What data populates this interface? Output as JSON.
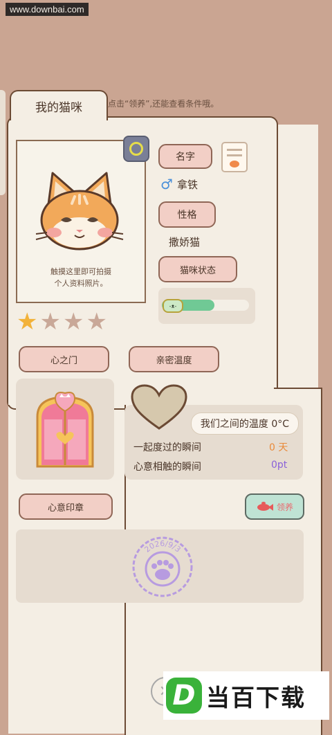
{
  "watermark": "www.downbai.com",
  "tab": {
    "title": "我的猫咪"
  },
  "hint": "点击“领养”,还能查看条件哦。",
  "profile": {
    "photo_caption_line1": "触摸这里即可拍摄",
    "photo_caption_line2": "个人资料照片。",
    "name_label": "名字",
    "gender_symbol": "♂",
    "name_value": "拿铁",
    "personality_label": "性格",
    "personality_value": "撒娇猫",
    "status_label": "猫咪状态",
    "status_face": "-ᴥ-",
    "status_level": 0.6,
    "stars_filled": 1,
    "stars_total": 5
  },
  "heart_gate": {
    "label": "心之门"
  },
  "intimacy": {
    "label": "亲密温度",
    "temperature_text": "我们之间的温度 0°C",
    "moments_label": "一起度过的瞬间",
    "moments_value": "0 天",
    "touch_label": "心意相触的瞬间",
    "touch_value": "0pt"
  },
  "seal": {
    "label": "心意印章",
    "adopt_label": "领养",
    "stamp_date": "2026/9/3"
  },
  "brand_logo": {
    "letter": "D",
    "text": "当百下载"
  },
  "colors": {
    "background": "#caa592",
    "panel": "#f4eee4",
    "pill": "#f2cfc6",
    "moments_value": "#e98a3a",
    "touch_value": "#8a62d9",
    "stamp": "#b79be0",
    "status_bar": "#70c995"
  },
  "icons": {
    "camera": "camera-icon",
    "notes": "notes-icon",
    "gender": "male-icon",
    "heart": "heart-icon",
    "gate": "heart-gate-icon",
    "paw": "paw-stamp-icon",
    "adopt": "fish-icon",
    "close": "close-icon"
  }
}
